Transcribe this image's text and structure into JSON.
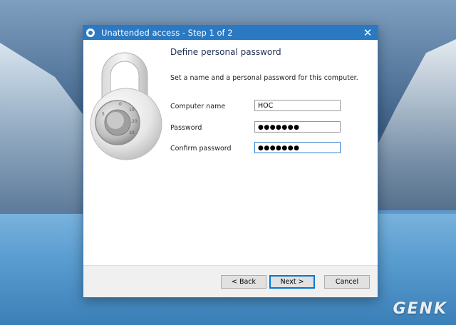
{
  "dialog": {
    "title": "Unattended access - Step 1 of 2",
    "close_symbol": "✕",
    "heading": "Define personal password",
    "description": "Set a name and a personal password for this computer.",
    "fields": {
      "computer_name": {
        "label": "Computer name",
        "value": "HOC"
      },
      "password": {
        "label": "Password",
        "value": "●●●●●●●"
      },
      "confirm_password": {
        "label": "Confirm password",
        "value": "●●●●●●●"
      }
    },
    "buttons": {
      "back": "< Back",
      "next": "Next >",
      "cancel": "Cancel"
    }
  },
  "watermark": "GENK",
  "colors": {
    "titlebar": "#2b79c2",
    "default_button_border": "#0078d7"
  },
  "icons": {
    "app": "teamviewer-icon",
    "illustration": "padlock-icon"
  }
}
